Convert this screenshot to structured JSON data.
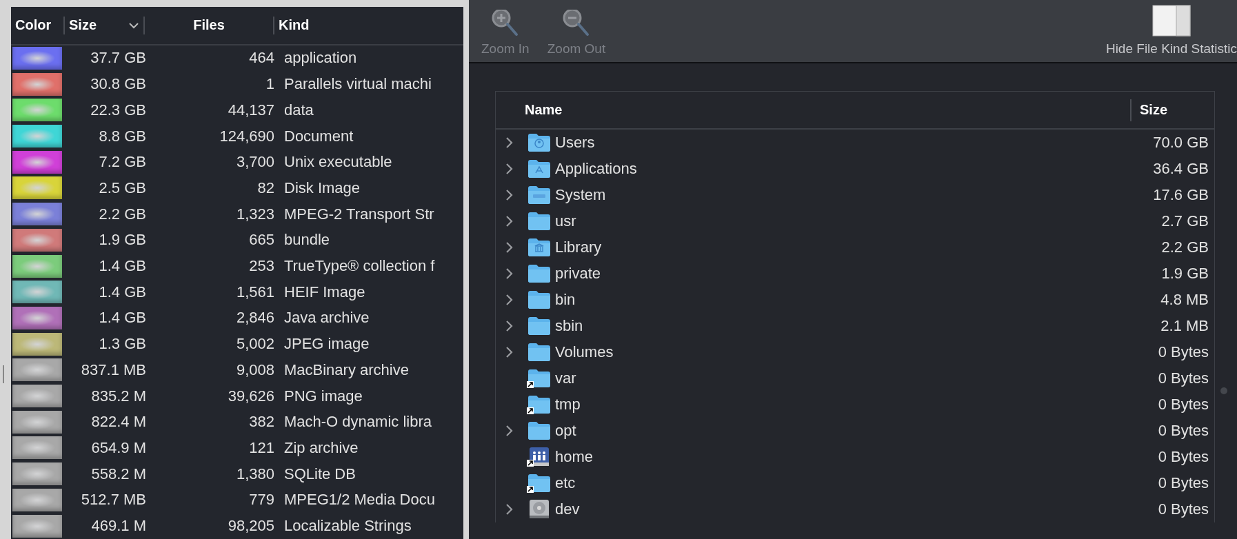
{
  "kind_statistics": {
    "columns": [
      {
        "label": "Color",
        "sorted": false
      },
      {
        "label": "Size",
        "sorted": true
      },
      {
        "label": "Files",
        "sorted": false
      },
      {
        "label": "Kind",
        "sorted": false
      }
    ],
    "rows": [
      {
        "color": "#6b6ff0",
        "size": "37.7 GB",
        "files": "464",
        "kind": "application"
      },
      {
        "color": "#e0706a",
        "size": "30.8 GB",
        "files": "1",
        "kind": "Parallels virtual machi"
      },
      {
        "color": "#6ddc6c",
        "size": "22.3 GB",
        "files": "44,137",
        "kind": "data"
      },
      {
        "color": "#3fd6d6",
        "size": "8.8 GB",
        "files": "124,690",
        "kind": "Document"
      },
      {
        "color": "#d040d8",
        "size": "7.2 GB",
        "files": "3,700",
        "kind": "Unix executable"
      },
      {
        "color": "#d8d43a",
        "size": "2.5 GB",
        "files": "82",
        "kind": "Disk Image"
      },
      {
        "color": "#7b80d8",
        "size": "2.2 GB",
        "files": "1,323",
        "kind": "MPEG-2 Transport Str"
      },
      {
        "color": "#d07a7a",
        "size": "1.9 GB",
        "files": "665",
        "kind": "bundle"
      },
      {
        "color": "#7ccc7c",
        "size": "1.4 GB",
        "files": "253",
        "kind": "TrueType® collection f"
      },
      {
        "color": "#70b8b6",
        "size": "1.4 GB",
        "files": "1,561",
        "kind": "HEIF Image"
      },
      {
        "color": "#b070b8",
        "size": "1.4 GB",
        "files": "2,846",
        "kind": "Java archive"
      },
      {
        "color": "#bcb878",
        "size": "1.3 GB",
        "files": "5,002",
        "kind": "JPEG image"
      },
      {
        "color": "#a8a8a8",
        "size": "837.1 MB",
        "files": "9,008",
        "kind": "MacBinary archive"
      },
      {
        "color": "#a8a8a8",
        "size": "835.2 M",
        "files": "39,626",
        "kind": "PNG image"
      },
      {
        "color": "#a8a8a8",
        "size": "822.4 M",
        "files": "382",
        "kind": "Mach-O dynamic libra"
      },
      {
        "color": "#a8a8a8",
        "size": "654.9 M",
        "files": "121",
        "kind": "Zip archive"
      },
      {
        "color": "#a8a8a8",
        "size": "558.2 M",
        "files": "1,380",
        "kind": "SQLite DB"
      },
      {
        "color": "#a8a8a8",
        "size": "512.7 MB",
        "files": "779",
        "kind": "MPEG1/2 Media Docu"
      },
      {
        "color": "#a8a8a8",
        "size": "469.1 M",
        "files": "98,205",
        "kind": "Localizable Strings"
      }
    ]
  },
  "toolbar": {
    "buttons": [
      {
        "label": "Zoom In",
        "kind": "zoom-in",
        "disabled": true
      },
      {
        "label": "Zoom Out",
        "kind": "zoom-out",
        "disabled": true
      },
      {
        "label": "Hide File Kind Statistic",
        "kind": "panel",
        "disabled": false
      }
    ]
  },
  "file_table": {
    "columns": [
      "Name",
      "Size"
    ],
    "rows": [
      {
        "kind": "user-folder",
        "name": "Users",
        "size": "70.0 GB",
        "expandable": true,
        "alias": false
      },
      {
        "kind": "apps-folder",
        "name": "Applications",
        "size": "36.4 GB",
        "expandable": true,
        "alias": false
      },
      {
        "kind": "system-folder",
        "name": "System",
        "size": "17.6 GB",
        "expandable": true,
        "alias": false
      },
      {
        "kind": "folder",
        "name": "usr",
        "size": "2.7 GB",
        "expandable": true,
        "alias": false
      },
      {
        "kind": "library-folder",
        "name": "Library",
        "size": "2.2 GB",
        "expandable": true,
        "alias": false
      },
      {
        "kind": "folder",
        "name": "private",
        "size": "1.9 GB",
        "expandable": true,
        "alias": false
      },
      {
        "kind": "folder",
        "name": "bin",
        "size": "4.8 MB",
        "expandable": true,
        "alias": false
      },
      {
        "kind": "folder",
        "name": "sbin",
        "size": "2.1 MB",
        "expandable": true,
        "alias": false
      },
      {
        "kind": "folder",
        "name": "Volumes",
        "size": "0 Bytes",
        "expandable": true,
        "alias": false
      },
      {
        "kind": "folder",
        "name": "var",
        "size": "0 Bytes",
        "expandable": false,
        "alias": true
      },
      {
        "kind": "folder",
        "name": "tmp",
        "size": "0 Bytes",
        "expandable": false,
        "alias": true
      },
      {
        "kind": "folder",
        "name": "opt",
        "size": "0 Bytes",
        "expandable": true,
        "alias": false
      },
      {
        "kind": "home-volume",
        "name": "home",
        "size": "0 Bytes",
        "expandable": false,
        "alias": true
      },
      {
        "kind": "folder",
        "name": "etc",
        "size": "0 Bytes",
        "expandable": false,
        "alias": true
      },
      {
        "kind": "disk",
        "name": "dev",
        "size": "0 Bytes",
        "expandable": true,
        "alias": false
      }
    ]
  }
}
